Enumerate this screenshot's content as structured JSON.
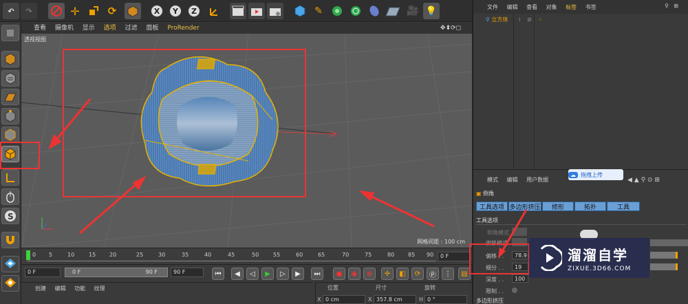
{
  "toolbar": {
    "undo_icon": "undo-icon",
    "axis_x": "X",
    "axis_y": "Y",
    "axis_z": "Z"
  },
  "viewport": {
    "menu": [
      "查看",
      "摄像机",
      "显示",
      "选项",
      "过滤",
      "面板",
      "ProRender"
    ],
    "label": "透视视图",
    "grid_spacing": "网格间距 : 100 cm"
  },
  "object_manager": {
    "menu": [
      "文件",
      "编辑",
      "查看",
      "对象",
      "标签",
      "书签"
    ],
    "object_name": "立方体"
  },
  "attributes": {
    "menu": [
      "模式",
      "编辑",
      "用户数据"
    ],
    "upload_label": "拖拽上传",
    "title": "倒角",
    "tabs": [
      "工具选项",
      "多边形挤压",
      "修形",
      "拓扑",
      "工具"
    ],
    "section": "工具选项",
    "rows": [
      {
        "label": "倒角模式",
        "value": ""
      },
      {
        "label": "偏移模式",
        "value": ""
      },
      {
        "label": "偏移 . .",
        "value": "78.9"
      },
      {
        "label": "细分 . .",
        "value": "19"
      },
      {
        "label": "深度 . .",
        "value": "100"
      },
      {
        "label": "限制 . .",
        "value": ""
      }
    ],
    "footer_section": "多边形挤压"
  },
  "timeline": {
    "ticks": [
      "0",
      "5",
      "10",
      "15",
      "20",
      "25",
      "30",
      "35",
      "40",
      "45",
      "50",
      "55",
      "60",
      "65",
      "70",
      "75",
      "80",
      "85",
      "90"
    ],
    "current_frame": "0 F",
    "start": "0 F",
    "range_start": "0 F",
    "range_end": "90 F",
    "end": "90 F"
  },
  "material_menu": [
    "创建",
    "编辑",
    "功能",
    "纹理"
  ],
  "coordinates": {
    "headers": [
      "位置",
      "尺寸",
      "旋转"
    ],
    "x_label": "X",
    "x_pos": "0 cm",
    "x_size_label": "X",
    "x_size": "357.8 cm",
    "h_label": "H",
    "h_rot": "0 °"
  },
  "watermark": {
    "brand": "溜溜自学",
    "url": "ZIXUE.3D66.COM"
  },
  "colors": {
    "viewport_bg": "#5b5b5b",
    "selection_yellow": "#f0b400",
    "annotation_red": "#ee3333",
    "panel_bg": "#3a3a3a",
    "tab_blue": "#6a9fd6"
  }
}
